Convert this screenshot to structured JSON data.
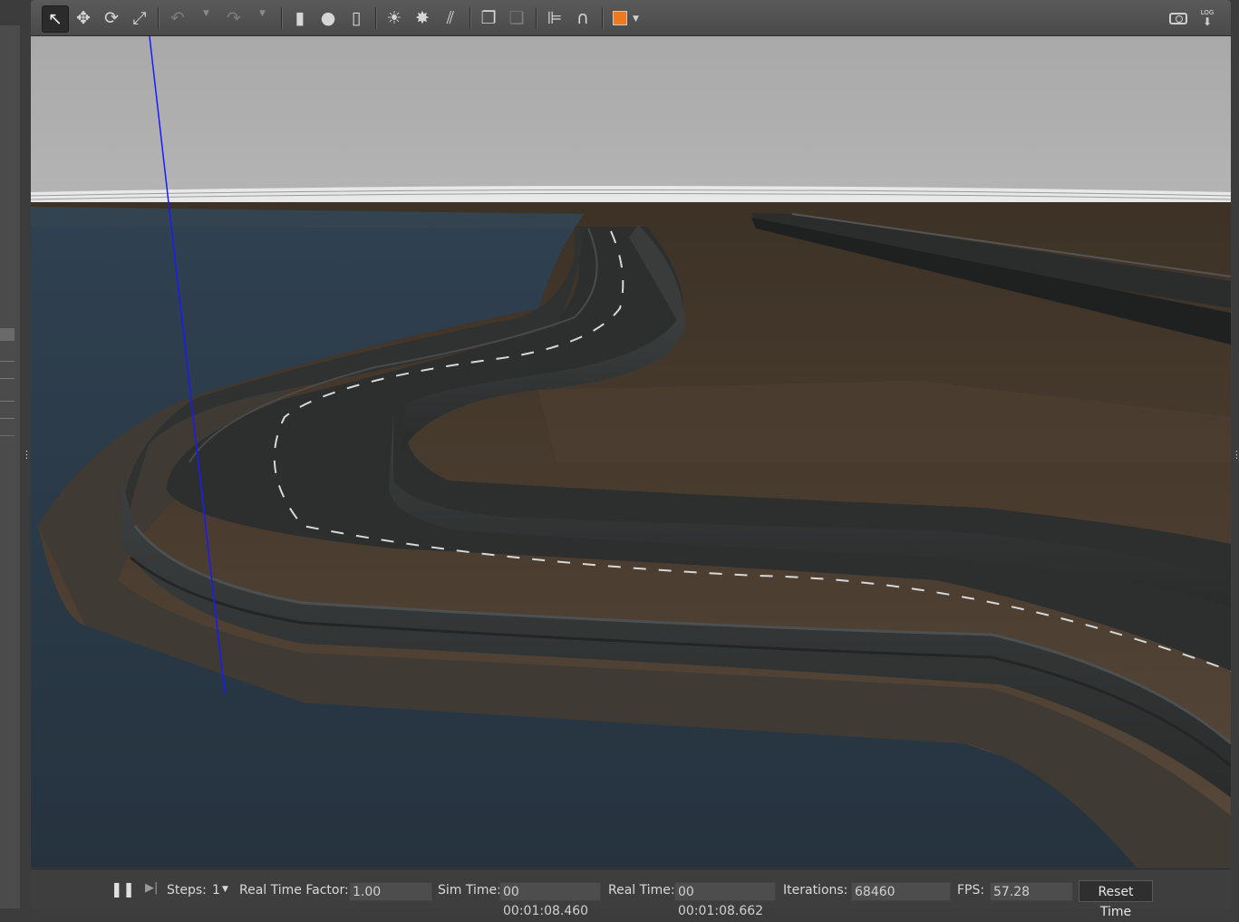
{
  "toolbar": {
    "icons": {
      "select": "↖",
      "translate": "✥",
      "rotate": "⟳",
      "scale": "⤢",
      "undo": "↶",
      "redo": "↷",
      "box": "▮",
      "sphere": "●",
      "cylinder": "▯",
      "point_light": "☀",
      "spot_light": "✸",
      "directional_light": "⫽",
      "copy": "❐",
      "paste": "❏",
      "align": "⊫",
      "snap": "∩",
      "view_angle": "◧",
      "screenshot": "📷",
      "log": "⎘"
    },
    "log_label": "LOG",
    "accent_color": "#f0781e"
  },
  "bottom": {
    "pause_icon": "❚❚",
    "step_icon": "▶|",
    "steps_label": "Steps:",
    "steps_value": "1",
    "rtf_label": "Real Time Factor:",
    "rtf_value": "1.00",
    "sim_time_label": "Sim Time:",
    "sim_time_value": "00 00:01:08.460",
    "real_time_label": "Real Time:",
    "real_time_value": "00 00:01:08.662",
    "iterations_label": "Iterations:",
    "iterations_value": "68460",
    "fps_label": "FPS:",
    "fps_value": "57.28",
    "reset_label": "Reset Time"
  },
  "scene": {
    "sky_color": "#a9a9a9",
    "water_color": "#2c3c4c",
    "ground_color": "#4a3d2e",
    "road_color": "#2e2e2e",
    "axis_color": "#1a1aff"
  }
}
